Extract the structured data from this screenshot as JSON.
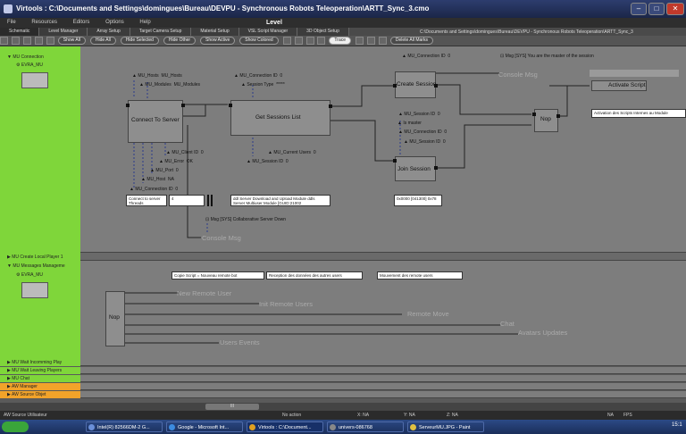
{
  "window": {
    "title": "Virtools : C:\\Documents and Settings\\domingues\\Bureau\\DEVPU - Synchronous Robots Teleoperation\\ARTT_Sync_3.cmo",
    "level_label": "Level"
  },
  "menubar": [
    "File",
    "Resources",
    "Editors",
    "Options",
    "Help"
  ],
  "tabs": [
    "Schematic",
    "Level Manager",
    "Array Setup",
    "Target Camera Setup",
    "Material Setup",
    "VSL Script Manager",
    "3D Object Setup"
  ],
  "path_text": "C:\\Documents and Settings\\domingues\\Bureau\\DEVPU - Synchronous Robots Teleoperation\\ARTT_Sync_3",
  "toolbar": {
    "buttons": [
      "Show All",
      "Hide All",
      "Hide Selected",
      "Hide Other",
      "Show Active",
      "Show Colored"
    ],
    "trace": "Trace",
    "delete_marks": "Delete All Marks"
  },
  "sections": {
    "mu_connection": "MU Connection",
    "evra_mu_1": "EVRA_MU",
    "mu_create_local_player": "MU Create Local Player 1",
    "mu_messages_management": "MU Messages Manageme",
    "evra_mu_2": "EVRA_MU"
  },
  "graph1": {
    "connect_to_server": "Connect To Server",
    "get_sessions_list": "Get Sessions List",
    "create_session": "Create Session",
    "join_session": "Join Session",
    "nop": "Nop",
    "activate_script": "Activate Script",
    "console_msg_1": "Console Msg",
    "console_msg_2": "Console Msg",
    "params": {
      "mu_hosts": "MU_Hosts",
      "mu_hosts_val": "MU_Hosts",
      "mu_modules": "MU_Modules",
      "mu_modules_val": "MU_Modules",
      "mu_conn_id_top": "MU_Connection ID",
      "mu_conn_id_top_val": "0",
      "session_type": "Session Type",
      "session_type_val": "*****",
      "mu_conn_id_create": "MU_Connection ID",
      "mu_conn_id_create_val": "0",
      "msg_master": "Msg [SYS] You are the master of the session",
      "mu_client_id": "MU_Client ID",
      "mu_client_id_val": "0",
      "mu_error": "MU_Error",
      "mu_error_val": "OK",
      "mu_port": "MU_Port",
      "mu_port_val": "0",
      "mu_host": "MU_Host",
      "mu_host_val": "NA",
      "mu_conn_id_bottom": "MU_Connection ID",
      "mu_conn_id_bottom_val": "0",
      "mu_current_users": "MU_Current Users",
      "mu_current_users_val": "0",
      "mu_session_id_a": "MU_Session ID",
      "mu_session_id_a_val": "0",
      "mu_session_id_b": "MU_Session ID",
      "mu_session_id_b_val": "0",
      "mu_conn_id_join": "MU_Connection ID",
      "mu_conn_id_join_val": "0",
      "mu_session_id_c": "MU_Session ID",
      "mu_session_id_c_val": "0",
      "is_master": "Is master",
      "msg_collab": "Msg [SYS] Collaborative Server Down"
    },
    "notes": {
      "connect_threads_label": "Connect to server Threads",
      "connect_threads_val": "4",
      "server_download": "ddl Server Download and Upload Module ddls Server Multiuser Module [GUID:21002",
      "guid_box": "0x0000 [041300] 0x78",
      "activation_note": "Activation des Scripts Internes au Module"
    }
  },
  "graph2": {
    "nop": "Nop",
    "new_remote_user": "New Remote User",
    "init_remote_users": "Init Remote Users",
    "remote_move": "Remote Move",
    "chat": "Chat",
    "avatars_updates": "Avatars Updates",
    "users_events": "Users Events",
    "note1": "Copie Script = Nouveau remote bot",
    "note2": "Reception des données des autres users",
    "note3": "Mouvement des remote users"
  },
  "collapsed": [
    {
      "label": "MU Wait Incomming Play",
      "color": "#7fd63a"
    },
    {
      "label": "MU Wait Leaving Players",
      "color": "#7fd63a"
    },
    {
      "label": "MU Chat",
      "color": "#7fd63a"
    },
    {
      "label": "AW Manager",
      "color": "#f2a32a"
    },
    {
      "label": "AW Source Objet",
      "color": "#f2a32a"
    }
  ],
  "status": {
    "source": "AW Source Utilisateur",
    "action": "No action",
    "x": "X:  NA",
    "y": "Y:  NA",
    "z": "Z:  NA",
    "fps_label": "FPS",
    "na": "NA",
    "scroll_val": "III"
  },
  "taskbar": {
    "items": [
      "Intel(R) 82566DM-2 G...",
      "Google - Microsoft Int...",
      "Virtools : C:\\Document...",
      "univers-086768",
      "ServeurMU.JPG - Paint"
    ],
    "time": "15:1"
  },
  "colors": {
    "section_green": "#7fd63a",
    "section_orange": "#f2a32a",
    "titlebar": "#1b2648"
  }
}
